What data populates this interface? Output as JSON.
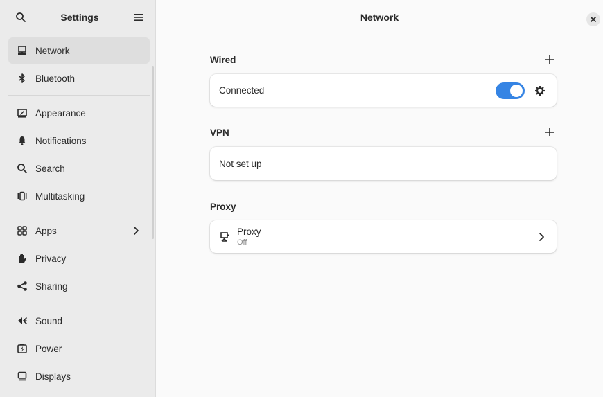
{
  "sidebar": {
    "title": "Settings",
    "groups": [
      [
        {
          "label": "Network",
          "icon": "network-wired-icon",
          "active": true
        },
        {
          "label": "Bluetooth",
          "icon": "bluetooth-icon"
        }
      ],
      [
        {
          "label": "Appearance",
          "icon": "appearance-icon"
        },
        {
          "label": "Notifications",
          "icon": "bell-icon"
        },
        {
          "label": "Search",
          "icon": "search-icon"
        },
        {
          "label": "Multitasking",
          "icon": "multitasking-icon"
        }
      ],
      [
        {
          "label": "Apps",
          "icon": "apps-grid-icon",
          "chevron": true
        },
        {
          "label": "Privacy",
          "icon": "hand-icon"
        },
        {
          "label": "Sharing",
          "icon": "share-icon"
        }
      ],
      [
        {
          "label": "Sound",
          "icon": "speaker-icon"
        },
        {
          "label": "Power",
          "icon": "power-battery-icon"
        },
        {
          "label": "Displays",
          "icon": "display-icon"
        }
      ]
    ]
  },
  "main": {
    "title": "Network",
    "wired": {
      "title": "Wired",
      "status": "Connected",
      "toggle_on": true
    },
    "vpn": {
      "title": "VPN",
      "status": "Not set up"
    },
    "proxy": {
      "title": "Proxy",
      "row_label": "Proxy",
      "row_sub": "Off"
    }
  },
  "colors": {
    "accent": "#3584e4",
    "sidebar_bg": "#ebebeb",
    "active_bg": "#dedede"
  }
}
